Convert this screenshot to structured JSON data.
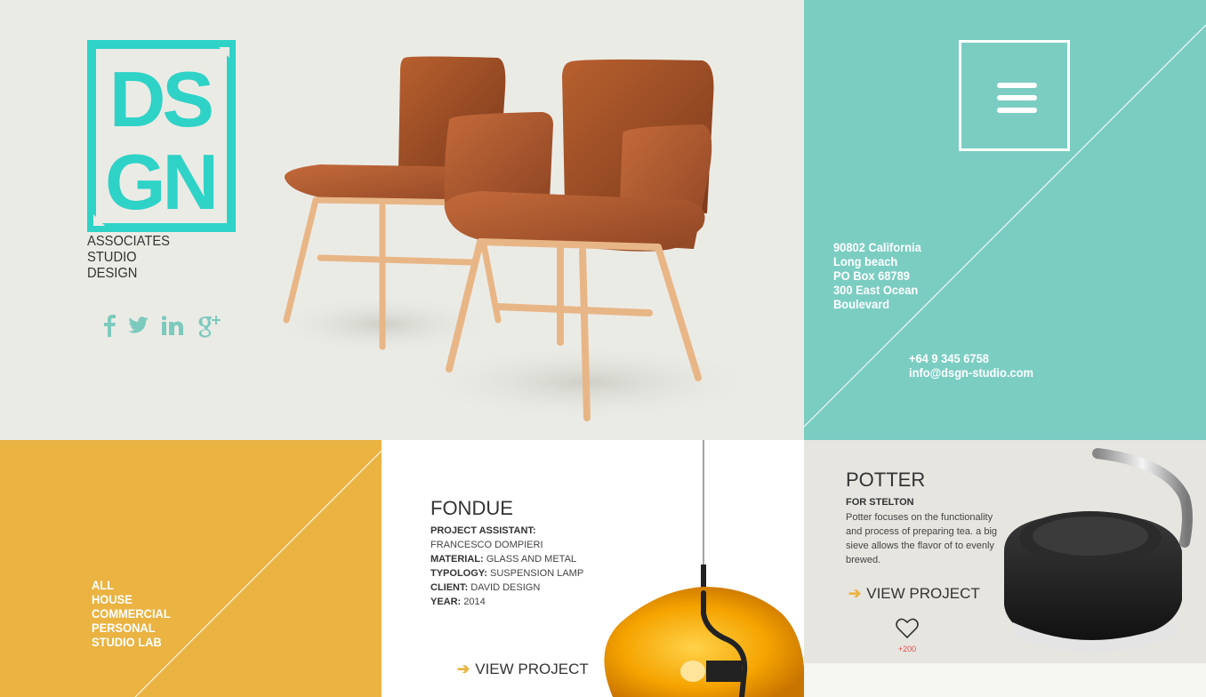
{
  "brand": {
    "logo_text": "DSGN",
    "tagline": [
      "ASSOCIATES",
      "STUDIO",
      "DESIGN"
    ],
    "social": [
      "facebook-icon",
      "twitter-icon",
      "linkedin-icon",
      "google-plus-icon"
    ]
  },
  "contact": {
    "address": [
      "90802 California",
      "Long beach",
      "PO Box 68789",
      "300 East Ocean",
      "Boulevard"
    ],
    "phone": "+64 9 345 6758",
    "email": "info@dsgn-studio.com"
  },
  "filter": {
    "items": [
      "ALL",
      "HOUSE",
      "COMMERCIAL",
      "PERSONAL",
      "STUDIO LAB"
    ]
  },
  "fondue": {
    "title": "FONDUE",
    "specs": [
      {
        "label": "PROJECT ASSISTANT:",
        "value": "FRANCESCO DOMPIERI"
      },
      {
        "label": "MATERIAL:",
        "value": "GLASS AND METAL"
      },
      {
        "label": "TYPOLOGY:",
        "value": "SUSPENSION LAMP"
      },
      {
        "label": "CLIENT:",
        "value": "DAVID DESIGN"
      },
      {
        "label": "YEAR:",
        "value": "2014"
      }
    ],
    "view_label": "VIEW PROJECT"
  },
  "potter": {
    "title": "POTTER",
    "client": "FOR STELTON",
    "description": "Potter focuses on the functionality and process of preparing tea. a big sieve allows the flavor of to evenly brewed.",
    "view_label": "VIEW PROJECT",
    "likes": "+200"
  },
  "colors": {
    "teal": "#7bcdc2",
    "logo_teal": "#2fd2c6",
    "mustard": "#eab342",
    "hero_bg": "#ebebe6"
  }
}
